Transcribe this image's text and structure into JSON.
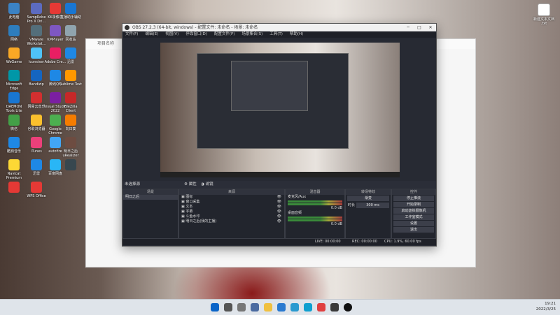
{
  "desktop_icons": [
    {
      "label": "此电脑",
      "color": "#3b82c4"
    },
    {
      "label": "SampRobe Pro X Dri...",
      "color": "#5c6bc0"
    },
    {
      "label": "KK录像机",
      "color": "#e53935"
    },
    {
      "label": "直播助手辅助",
      "color": "#1976d2"
    },
    {
      "label": "网络",
      "color": "#2e7dbd"
    },
    {
      "label": "VMware Workstat...",
      "color": "#546e7a"
    },
    {
      "label": "KMPlayer",
      "color": "#7e57c2"
    },
    {
      "label": "回收站",
      "color": "#90a4ae"
    },
    {
      "label": "WeGame",
      "color": "#f9a825"
    },
    {
      "label": "Iconsiser",
      "color": "#4fc3f7"
    },
    {
      "label": "Adobe Cre...",
      "color": "#e91e63"
    },
    {
      "label": "迅雷",
      "color": "#1e88e5"
    },
    {
      "label": "Microsoft Edge",
      "color": "#0097a7"
    },
    {
      "label": "Bandizip",
      "color": "#1565c0"
    },
    {
      "label": "腾讯QQ",
      "color": "#1e88e5"
    },
    {
      "label": "Sublime Text",
      "color": "#ff9800"
    },
    {
      "label": "DAEMON Tools Lite",
      "color": "#1976d2"
    },
    {
      "label": "网易云音乐",
      "color": "#d32f2f"
    },
    {
      "label": "Visual Studio 2022",
      "color": "#7b1fa2"
    },
    {
      "label": "FileZilla Client",
      "color": "#c62828"
    },
    {
      "label": "微信",
      "color": "#43a047"
    },
    {
      "label": "谷歌浏览器",
      "color": "#fbc02d"
    },
    {
      "label": "Google Chrome",
      "color": "#4caf50"
    },
    {
      "label": "向日葵",
      "color": "#f57c00"
    },
    {
      "label": "酷狗音乐",
      "color": "#1e88e5"
    },
    {
      "label": "iTunes",
      "color": "#ec407a"
    },
    {
      "label": "autofire",
      "color": "#42a5f5"
    },
    {
      "label": "明日之后 uRealizer",
      "color": "#6d4c41"
    },
    {
      "label": "Navicat Premium",
      "color": "#fdd835"
    },
    {
      "label": "迅雷",
      "color": "#1e88e5"
    },
    {
      "label": "百度网盘",
      "color": "#29b6f6"
    },
    {
      "label": "",
      "color": "#37474f"
    },
    {
      "label": "",
      "color": "#e53935"
    },
    {
      "label": "WPS Office",
      "color": "#e53935"
    }
  ],
  "right_desktop_icon": {
    "label": "新建文本文档 .txt"
  },
  "bg_window_title": "项目名称",
  "obs": {
    "title": "OBS 27.2.3 (64-bit, windows) - 配置文件: 未命名 - 场景: 未命名",
    "menu": [
      "文件(F)",
      "编辑(E)",
      "视图(V)",
      "停靠窗口(D)",
      "配置文件(P)",
      "场景集合(S)",
      "工具(T)",
      "帮助(H)"
    ],
    "scene_info": "未选择源",
    "props_btn": "属性",
    "filter_btn": "滤镜",
    "docks": {
      "scenes": {
        "title": "场景",
        "items": [
          "明日之后"
        ]
      },
      "sources": {
        "title": "来源",
        "items": [
          "图标",
          "窗口采集",
          "文本",
          "字幕",
          "斗鱼水印",
          "明日之后(我的主播)"
        ]
      },
      "mixer": {
        "title": "混音器",
        "channels": [
          {
            "name": "麦克风/Aux",
            "db": "0.0 dB"
          },
          {
            "name": "桌面音频",
            "db": "0.0 dB"
          }
        ]
      },
      "transitions": {
        "title": "转场特效",
        "type": "渐变",
        "duration_label": "时长",
        "duration": "300 ms"
      },
      "controls": {
        "title": "控件",
        "buttons": [
          "停止推流",
          "开始录制",
          "启动虚拟摄像机",
          "工作室模式",
          "设置",
          "退出"
        ]
      }
    },
    "status": {
      "live": "LIVE: 00:00:00",
      "rec": "REC: 00:00:00",
      "cpu": "CPU: 1.9%, 60.00 fps"
    }
  },
  "taskbar": {
    "time": "19:21",
    "date": "2022/3/25"
  }
}
